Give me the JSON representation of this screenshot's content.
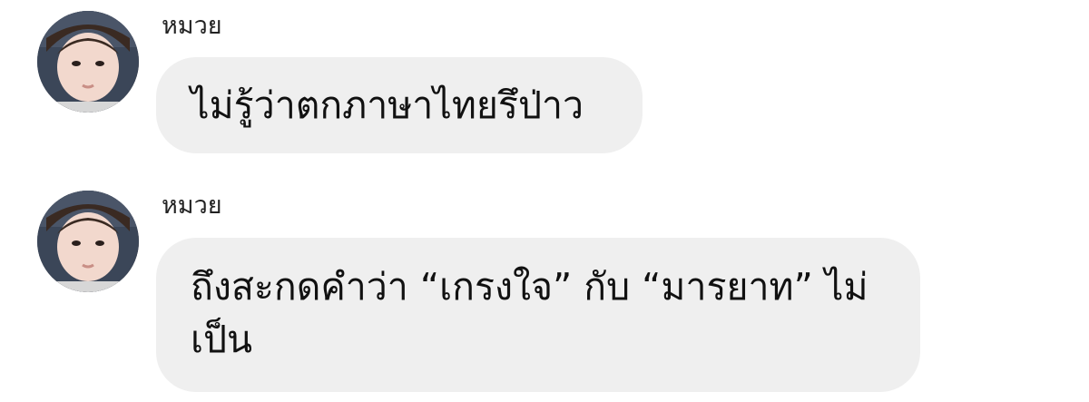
{
  "conversation": {
    "messages": [
      {
        "sender": "หมวย",
        "avatar_icon": "user-avatar-photo",
        "text": "ไม่รู้ว่าตกภาษาไทยรึป่าว"
      },
      {
        "sender": "หมวย",
        "avatar_icon": "user-avatar-photo",
        "text": "ถึงสะกดคำว่า “เกรงใจ” กับ “มารยาท” ไม่เป็น"
      }
    ]
  },
  "colors": {
    "bubble_background": "#efefef",
    "page_background": "#ffffff",
    "text": "#111111"
  }
}
